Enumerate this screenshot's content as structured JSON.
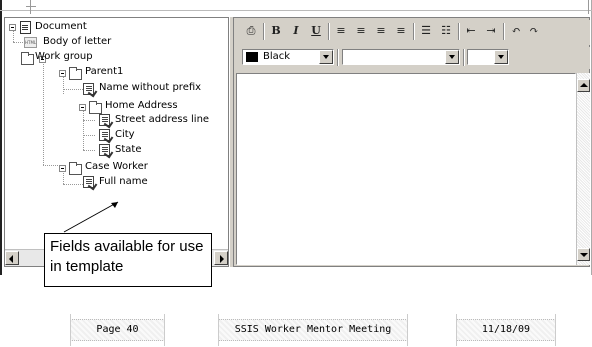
{
  "tree": {
    "items": [
      {
        "label": "Document"
      },
      {
        "label": "Body of letter"
      },
      {
        "label": "Work group"
      },
      {
        "label": "Parent1"
      },
      {
        "label": "Name without prefix"
      },
      {
        "label": "Home Address"
      },
      {
        "label": "Street address line"
      },
      {
        "label": "City"
      },
      {
        "label": "State"
      },
      {
        "label": "Case Worker"
      },
      {
        "label": "Full name"
      }
    ]
  },
  "callout": {
    "text": "Fields available for use in template"
  },
  "toolbar": {
    "bold": "B",
    "italic": "I",
    "underline": "U",
    "color_value": "Black",
    "font_value": "",
    "size_value": ""
  },
  "footer": {
    "page": "Page 40",
    "title": "SSIS Worker Mentor Meeting",
    "date": "11/18/09"
  },
  "colors": {
    "swatch": "#000000",
    "chrome": "#d4d0c8"
  }
}
